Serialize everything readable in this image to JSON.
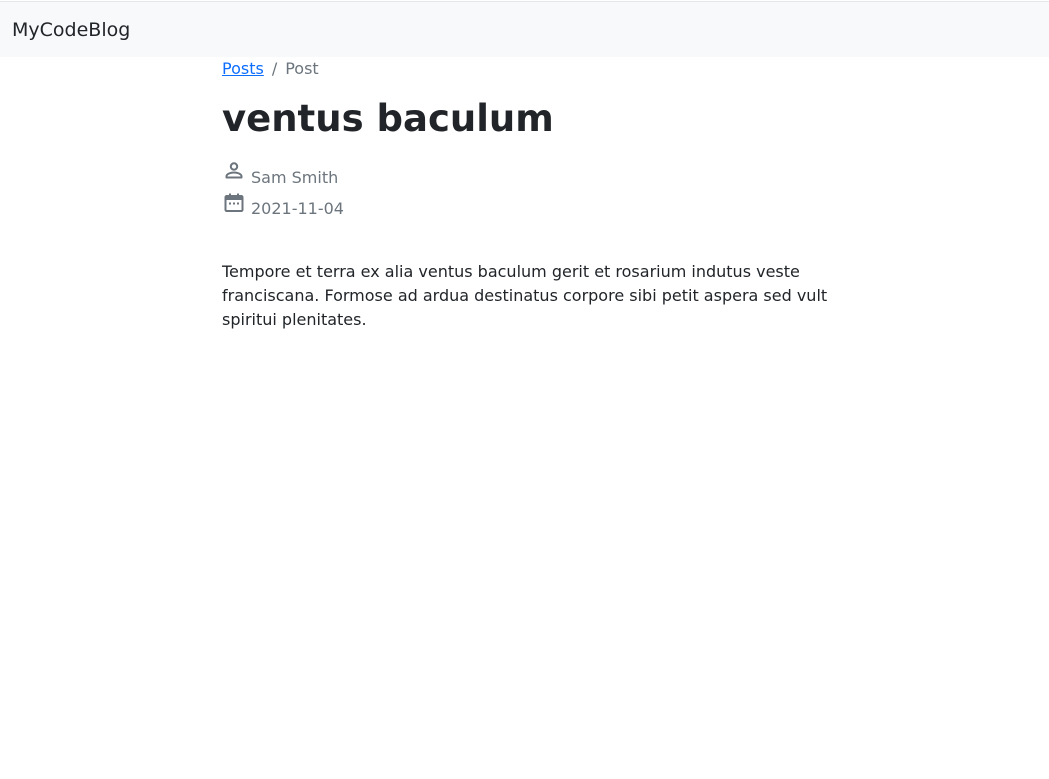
{
  "navbar": {
    "brand": "MyCodeBlog"
  },
  "breadcrumb": {
    "items": [
      {
        "label": "Posts",
        "link": true
      },
      {
        "label": "Post",
        "link": false
      }
    ],
    "separator": "/"
  },
  "post": {
    "title": "ventus baculum",
    "author": "Sam Smith",
    "date": "2021-11-04",
    "body": "Tempore et terra ex alia ventus baculum gerit et rosarium indutus veste franciscana. Formose ad ardua destinatus corpore sibi petit aspera sed vult spiritui plenitates."
  },
  "icons": {
    "author": "person-icon",
    "date": "calendar-icon"
  },
  "colors": {
    "navbar_bg": "#f8f9fa",
    "link": "#0d6efd",
    "muted": "#6c757d",
    "text": "#212529"
  }
}
